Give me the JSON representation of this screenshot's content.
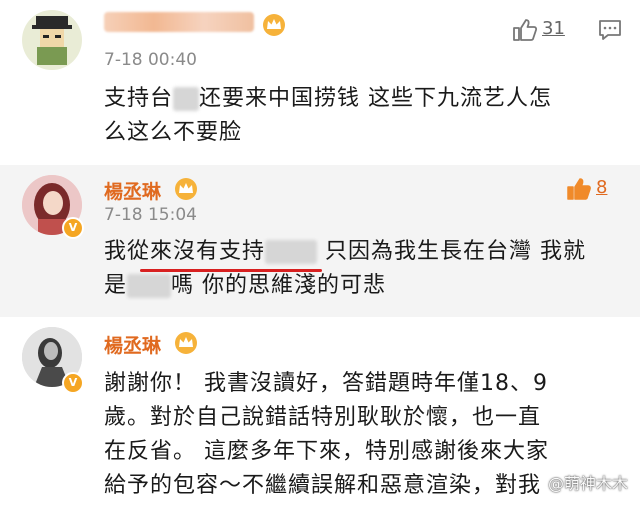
{
  "comments": [
    {
      "time": "7-18 00:40",
      "text_a": "支持台",
      "text_b": "还要来中国捞钱 这些下九流艺人怎",
      "text_c": "么这么不要脸",
      "likes": "31"
    },
    {
      "name": "楊丞琳",
      "time": "7-18 15:04",
      "text_a": "我從來沒有支持",
      "text_b": "只因為我生長在台灣 我就",
      "text_c": "是",
      "text_d": "嗎 你的思維淺的可悲",
      "likes": "8"
    },
    {
      "name": "楊丞琳",
      "lines": [
        "謝謝你！ 我書沒讀好，答錯題時年僅18、9",
        "歲。對於自己說錯話特別耿耿於懷，也一直",
        "在反省。 這麼多年下來，特別感謝後來大家",
        "給予的包容～不繼續誤解和惡意渲染，"
      ],
      "tail": "對我"
    }
  ],
  "watermark": "@萌神木木",
  "colors": {
    "name": "#e06a20",
    "like_active": "#f08a2a",
    "underline": "#d82020"
  }
}
